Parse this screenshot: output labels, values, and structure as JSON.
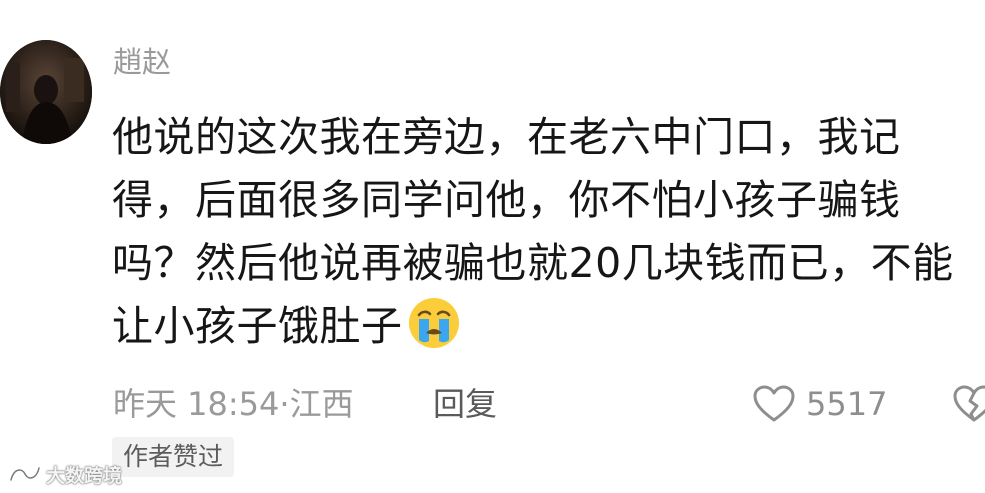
{
  "comment": {
    "username": "趙赵",
    "text_lines": [
      "他说的这次我在旁边，在老六中门口，我记",
      "得，后面很多同学问他，你不怕小孩子骗钱",
      "吗？然后他说再被骗也就20几块钱而已，不能",
      "让小孩子饿肚子"
    ],
    "emoji": "crying-face-emoji",
    "timestamp": "昨天 18:54",
    "separator": "·",
    "location": "江西",
    "reply_label": "回复",
    "like_count": "5517",
    "author_badge": "作者赞过"
  },
  "watermark": {
    "text": "大数跨境"
  },
  "icons": {
    "like": "heart-outline-icon",
    "dislike": "broken-heart-icon"
  },
  "colors": {
    "text_primary": "#161616",
    "text_secondary": "#9a9a9a",
    "badge_background": "#f2f2f2",
    "emoji_face": "#fbcd3b",
    "emoji_tears": "#3aa7f0"
  }
}
